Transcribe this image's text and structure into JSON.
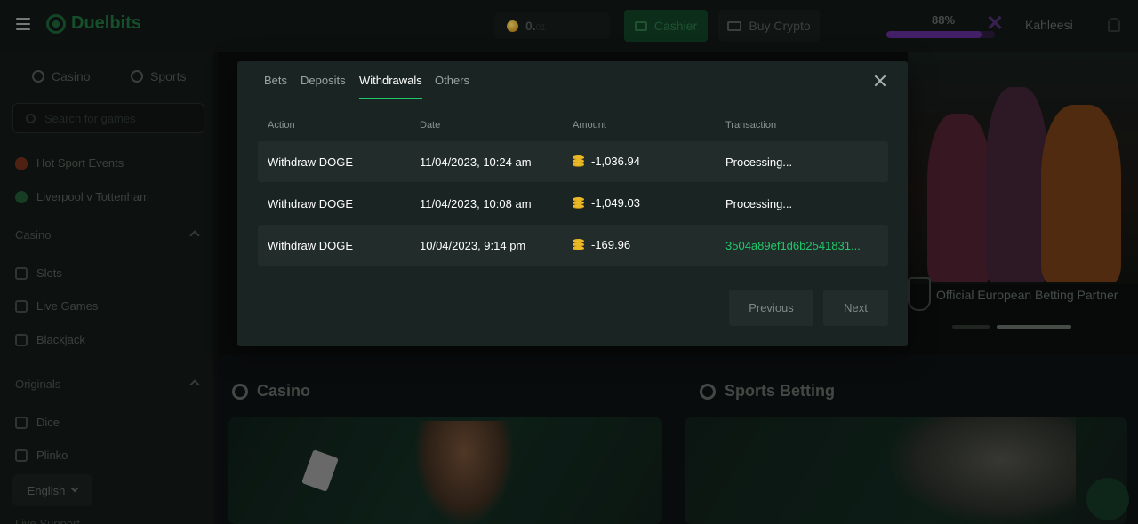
{
  "header": {
    "brand": "Duelbits",
    "balance": "0.",
    "balance_dim": "01",
    "cashier_label": "Cashier",
    "buy_crypto_label": "Buy Crypto",
    "level_percent": "88%",
    "level_fraction": 0.88,
    "username": "Kahleesi"
  },
  "sidebar": {
    "tabs": [
      {
        "label": "Casino"
      },
      {
        "label": "Sports"
      }
    ],
    "search_placeholder": "Search for games",
    "items_top": [
      {
        "label": "Hot Sport Events"
      },
      {
        "label": "Liverpool v Tottenham"
      }
    ],
    "casino_header": "Casino",
    "casino_items": [
      {
        "label": "Slots"
      },
      {
        "label": "Live Games"
      },
      {
        "label": "Blackjack"
      }
    ],
    "originals_header": "Originals",
    "originals_items": [
      {
        "label": "Dice"
      },
      {
        "label": "Plinko"
      }
    ],
    "language": "English",
    "support": "Live Support"
  },
  "main": {
    "partner_text": "Official European Betting Partner",
    "casino_title": "Casino",
    "sports_title": "Sports Betting"
  },
  "modal": {
    "tabs": [
      {
        "label": "Bets"
      },
      {
        "label": "Deposits"
      },
      {
        "label": "Withdrawals"
      },
      {
        "label": "Others"
      }
    ],
    "active_tab": "Withdrawals",
    "columns": [
      "Action",
      "Date",
      "Amount",
      "Transaction"
    ],
    "rows": [
      {
        "action": "Withdraw DOGE",
        "date": "11/04/2023, 10:24 am",
        "amount": "-1,036.94",
        "transaction": "Processing..."
      },
      {
        "action": "Withdraw DOGE",
        "date": "11/04/2023, 10:08 am",
        "amount": "-1,049.03",
        "transaction": "Processing..."
      },
      {
        "action": "Withdraw DOGE",
        "date": "10/04/2023, 9:14 pm",
        "amount": "-169.96",
        "transaction": "3504a89ef1d6b2541831..."
      }
    ],
    "previous_label": "Previous",
    "next_label": "Next"
  },
  "colors": {
    "accent_green": "#1fc76a",
    "modal_bg": "#1a2422",
    "row_bg": "#222d2b",
    "coin_gold": "#e9b826"
  }
}
